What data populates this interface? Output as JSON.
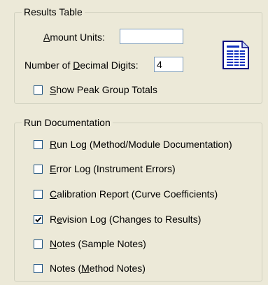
{
  "results_table": {
    "title": "Results Table",
    "amount_units": {
      "label_pre": "",
      "label_key": "A",
      "label_post": "mount Units:",
      "value": ""
    },
    "decimal_digits": {
      "label_pre": "Number of ",
      "label_key": "D",
      "label_post": "ecimal Digits:",
      "value": "4"
    },
    "show_peak_group_totals": {
      "label_pre": "",
      "label_key": "S",
      "label_post": "how Peak Group Totals",
      "checked": false
    }
  },
  "report_icon": "document-report-icon",
  "run_documentation": {
    "title": "Run Documentation",
    "items": [
      {
        "label_pre": "",
        "label_key": "R",
        "label_post": "un Log (Method/Module Documentation)",
        "checked": false
      },
      {
        "label_pre": "",
        "label_key": "E",
        "label_post": "rror Log (Instrument Errors)",
        "checked": false
      },
      {
        "label_pre": "",
        "label_key": "C",
        "label_post": "alibration Report (Curve Coefficients)",
        "checked": false
      },
      {
        "label_pre": "R",
        "label_key": "e",
        "label_post": "vision Log (Changes to Results)",
        "checked": true
      },
      {
        "label_pre": "",
        "label_key": "N",
        "label_post": "otes (Sample Notes)",
        "checked": false
      },
      {
        "label_pre": "Notes (",
        "label_key": "M",
        "label_post": "ethod Notes)",
        "checked": false
      }
    ]
  }
}
